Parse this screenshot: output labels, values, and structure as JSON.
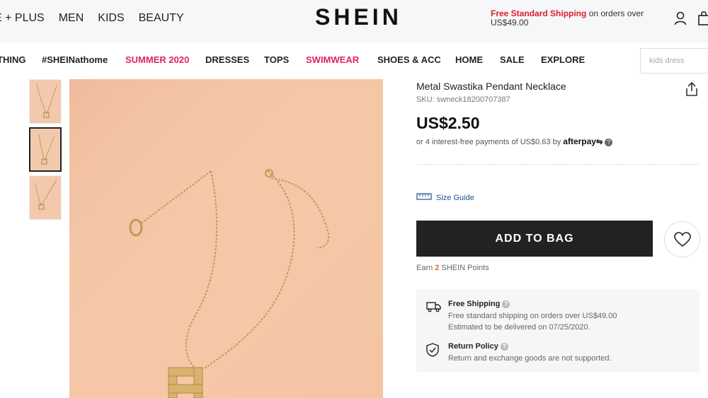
{
  "header": {
    "nav": [
      "E + PLUS",
      "MEN",
      "KIDS",
      "BEAUTY"
    ],
    "logo": "SHEIN",
    "promo_highlight": "Free Standard Shipping",
    "promo_rest": " on orders over US$49.00"
  },
  "categories": [
    {
      "label": "THING",
      "highlight": false
    },
    {
      "label": "#SHEINathome",
      "highlight": false
    },
    {
      "label": "SUMMER 2020",
      "highlight": true
    },
    {
      "label": "DRESSES",
      "highlight": false
    },
    {
      "label": "TOPS",
      "highlight": false
    },
    {
      "label": "SWIMWEAR",
      "highlight": true
    },
    {
      "label": "SHOES & ACC",
      "highlight": false
    },
    {
      "label": "HOME",
      "highlight": false
    },
    {
      "label": "SALE",
      "highlight": false
    },
    {
      "label": "EXPLORE",
      "highlight": false
    }
  ],
  "search": {
    "placeholder": "kids dress"
  },
  "product": {
    "title": "Metal Swastika Pendant Necklace",
    "sku": "SKU: swneck18200707387",
    "price": "US$2.50",
    "afterpay_text": "or 4 interest-free payments of US$0.63 by ",
    "afterpay_brand": "afterpay",
    "size_guide": "Size Guide",
    "add_to_bag": "ADD TO BAG",
    "earn_prefix": "Earn ",
    "earn_points": "2",
    "earn_suffix": " SHEIN Points"
  },
  "shipping": {
    "title": "Free Shipping",
    "line1": "Free standard shipping on orders over US$49.00",
    "line2": "Estimated to be delivered on 07/25/2020."
  },
  "returns": {
    "title": "Return Policy",
    "line1": "Return and exchange goods are not supported."
  },
  "colors": {
    "accent_pink": "#e0245e",
    "promo_red": "#e01c2b",
    "image_bg": "#f5c7a7",
    "button_dark": "#222222"
  },
  "icons": [
    "user-icon",
    "bag-icon",
    "share-icon",
    "ruler-icon",
    "heart-icon",
    "truck-icon",
    "shield-check-icon",
    "help-icon"
  ]
}
